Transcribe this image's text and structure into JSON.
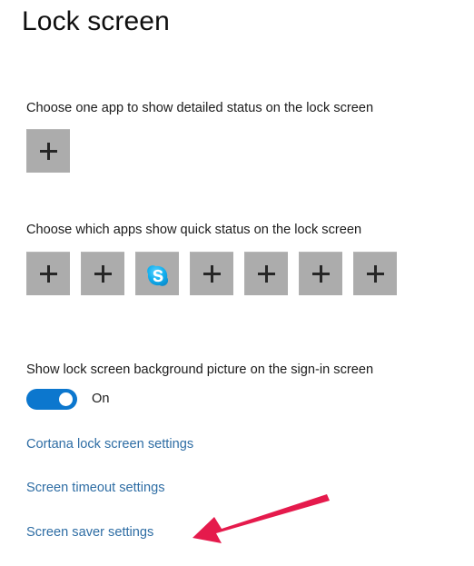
{
  "header": {
    "title": "Lock screen"
  },
  "sections": {
    "detailed_status": {
      "label": "Choose one app to show detailed status on the lock screen",
      "tiles": [
        {
          "name": "add-app-tile",
          "icon": "plus-icon",
          "app": null
        }
      ]
    },
    "quick_status": {
      "label": "Choose which apps show quick status on the lock screen",
      "tiles": [
        {
          "name": "add-app-tile",
          "icon": "plus-icon",
          "app": null
        },
        {
          "name": "add-app-tile",
          "icon": "plus-icon",
          "app": null
        },
        {
          "name": "app-tile-skype",
          "icon": "skype-icon",
          "app": "Skype"
        },
        {
          "name": "add-app-tile",
          "icon": "plus-icon",
          "app": null
        },
        {
          "name": "add-app-tile",
          "icon": "plus-icon",
          "app": null
        },
        {
          "name": "add-app-tile",
          "icon": "plus-icon",
          "app": null
        },
        {
          "name": "add-app-tile",
          "icon": "plus-icon",
          "app": null
        }
      ]
    },
    "background_picture": {
      "label": "Show lock screen background picture on the sign-in screen",
      "toggle_state": "On"
    }
  },
  "links": [
    {
      "label": "Cortana lock screen settings"
    },
    {
      "label": "Screen timeout settings"
    },
    {
      "label": "Screen saver settings"
    }
  ],
  "annotation": {
    "type": "arrow",
    "points_to": "Screen saver settings",
    "color": "#e51a4c"
  },
  "colors": {
    "accent_blue": "#0c77ce",
    "link_blue": "#2e6da4",
    "tile_grey": "#acacac",
    "skype_blue": "#00aff0",
    "annotation_pink": "#e51a4c",
    "background": "#ffffff",
    "text": "#1b1b1b"
  }
}
